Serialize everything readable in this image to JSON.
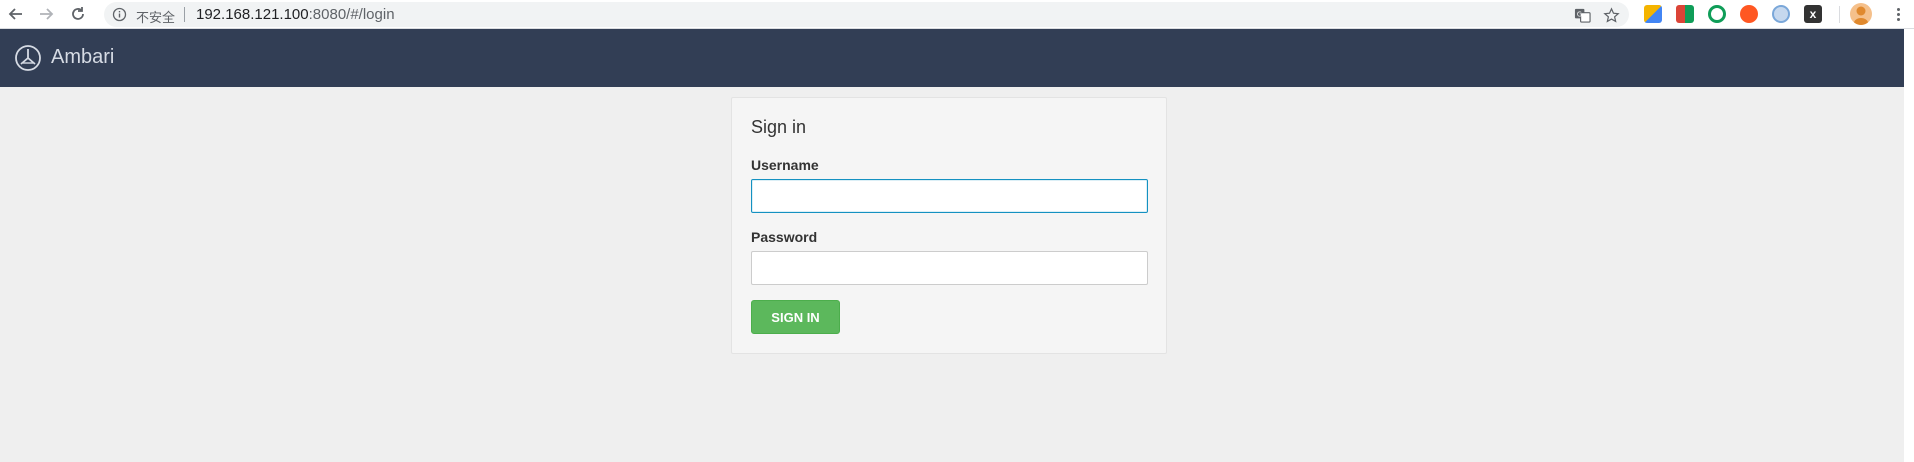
{
  "browser": {
    "insecure_label": "不安全",
    "url_host": "192.168.121.100",
    "url_rest": ":8080/#/login",
    "icons": [
      "back-arrow-icon",
      "forward-arrow-icon",
      "reload-icon",
      "info-icon",
      "translate-icon",
      "bookmark-star-icon"
    ],
    "extensions": [
      {
        "name": "extension-1-icon",
        "color": "#f4b400"
      },
      {
        "name": "extension-2-icon",
        "color": "#db4437"
      },
      {
        "name": "extension-3-icon",
        "color": "#0f9d58"
      },
      {
        "name": "extension-4-icon",
        "color": "#ff5722"
      },
      {
        "name": "extension-5-icon",
        "color": "#7aa7d9"
      },
      {
        "name": "extension-6-icon",
        "color": "#333333"
      }
    ]
  },
  "app": {
    "brand_name": "Ambari",
    "header_color": "#323e55"
  },
  "login": {
    "title": "Sign in",
    "username_label": "Username",
    "username_value": "",
    "password_label": "Password",
    "password_value": "",
    "submit_label": "SIGN IN",
    "submit_color": "#5cb85c",
    "focus_color": "#1491c1"
  }
}
